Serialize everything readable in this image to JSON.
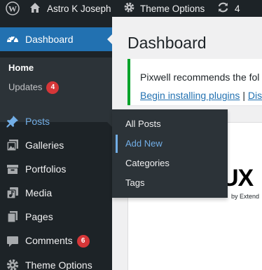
{
  "admin_bar": {
    "site_name": "Astro K Joseph",
    "theme_options": "Theme Options",
    "updates_count": "4"
  },
  "sidebar": {
    "dashboard": "Dashboard",
    "submenu": {
      "home": "Home",
      "updates": "Updates",
      "updates_badge": "4"
    },
    "items": [
      {
        "label": "Posts",
        "icon": "pushpin-icon"
      },
      {
        "label": "Galleries",
        "icon": "gallery-icon"
      },
      {
        "label": "Portfolios",
        "icon": "portfolio-icon"
      },
      {
        "label": "Media",
        "icon": "media-icon"
      },
      {
        "label": "Pages",
        "icon": "pages-icon"
      },
      {
        "label": "Comments",
        "icon": "comment-icon",
        "badge": "6"
      },
      {
        "label": "Theme Options",
        "icon": "gear-icon"
      }
    ]
  },
  "flyout": {
    "items": [
      "All Posts",
      "Add New",
      "Categories",
      "Tags"
    ],
    "active_index": 1
  },
  "main": {
    "title": "Dashboard",
    "notice": {
      "text": "Pixwell recommends the fol",
      "link_install": "Begin installing plugins",
      "separator": "|",
      "link_dismiss": "Dis"
    },
    "card": {
      "logo_text": "UX",
      "logo_sub": "by Extend"
    }
  },
  "colors": {
    "admin_dark": "#1d2327",
    "accent_blue": "#2271b1",
    "badge_red": "#d63638",
    "notice_green": "#00a32a"
  }
}
